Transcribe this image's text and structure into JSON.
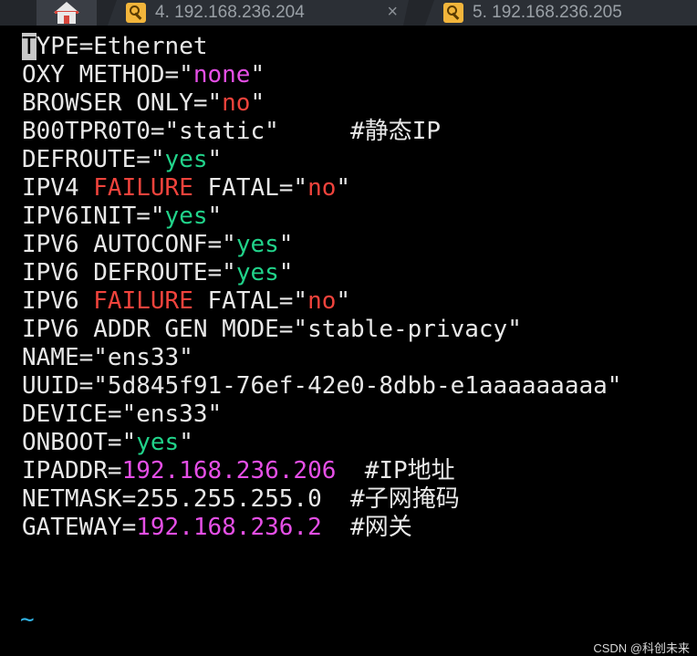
{
  "tabs": {
    "home": {
      "icon": "home-icon"
    },
    "tab1": {
      "label": "4. 192.168.236.204",
      "icon": "key-icon",
      "close": "×"
    },
    "tab2": {
      "label": "5. 192.168.236.205",
      "icon": "key-icon"
    }
  },
  "editor": {
    "lines": [
      [
        {
          "t": "T",
          "c": "cursor"
        },
        {
          "t": "YPE=Ethernet"
        }
      ],
      [
        {
          "t": "OXY METHOD=\""
        },
        {
          "t": "none",
          "c": "c-mag"
        },
        {
          "t": "\""
        }
      ],
      [
        {
          "t": "BROWSER ONLY=\""
        },
        {
          "t": "no",
          "c": "c-red"
        },
        {
          "t": "\""
        }
      ],
      [
        {
          "t": "B00TPR0T0=\"static\"     #"
        },
        {
          "t": "静态",
          "c": "cjk"
        },
        {
          "t": "IP"
        }
      ],
      [
        {
          "t": "DEFROUTE=\""
        },
        {
          "t": "yes",
          "c": "c-grn"
        },
        {
          "t": "\""
        }
      ],
      [
        {
          "t": "IPV4 "
        },
        {
          "t": "FAILURE",
          "c": "c-red"
        },
        {
          "t": " FATAL=\""
        },
        {
          "t": "no",
          "c": "c-red"
        },
        {
          "t": "\""
        }
      ],
      [
        {
          "t": "IPV6INIT=\""
        },
        {
          "t": "yes",
          "c": "c-grn"
        },
        {
          "t": "\""
        }
      ],
      [
        {
          "t": "IPV6 AUTOCONF=\""
        },
        {
          "t": "yes",
          "c": "c-grn"
        },
        {
          "t": "\""
        }
      ],
      [
        {
          "t": "IPV6 DEFROUTE=\""
        },
        {
          "t": "yes",
          "c": "c-grn"
        },
        {
          "t": "\""
        }
      ],
      [
        {
          "t": "IPV6 "
        },
        {
          "t": "FAILURE",
          "c": "c-red"
        },
        {
          "t": " FATAL=\""
        },
        {
          "t": "no",
          "c": "c-red"
        },
        {
          "t": "\""
        }
      ],
      [
        {
          "t": "IPV6 ADDR GEN MODE=\"stable-privacy\""
        }
      ],
      [
        {
          "t": "NAME=\"ens33\""
        }
      ],
      [
        {
          "t": "UUID=\"5d845f91-76ef-42e0-8dbb-e1aaaaaaaaa\""
        }
      ],
      [
        {
          "t": "DEVICE=\"ens33\""
        }
      ],
      [
        {
          "t": "ONBOOT=\""
        },
        {
          "t": "yes",
          "c": "c-grn"
        },
        {
          "t": "\""
        }
      ],
      [
        {
          "t": "IPADDR="
        },
        {
          "t": "192.168.236.206",
          "c": "c-mag"
        },
        {
          "t": "  #IP"
        },
        {
          "t": "地址",
          "c": "cjk"
        }
      ],
      [
        {
          "t": "NETMASK=255.255.255.0  #"
        },
        {
          "t": "子网掩码",
          "c": "cjk"
        }
      ],
      [
        {
          "t": "GATEWAY="
        },
        {
          "t": "192.168.236.2",
          "c": "c-mag"
        },
        {
          "t": "  #"
        },
        {
          "t": "网关",
          "c": "cjk"
        }
      ]
    ],
    "tilde": "~"
  },
  "watermark": "CSDN @科创未来",
  "colors": {
    "background": "#000000",
    "text": "#e8e8e8",
    "magenta": "#e54fe6",
    "red": "#f0433c",
    "green": "#21d38a",
    "tilde": "#31b3e6"
  }
}
